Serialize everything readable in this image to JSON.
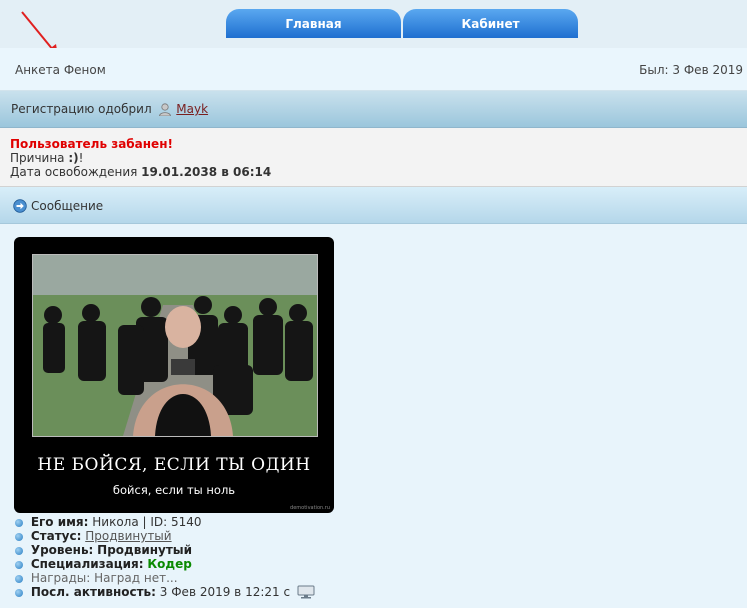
{
  "nav": {
    "tabs": [
      {
        "label": "Главная"
      },
      {
        "label": "Кабинет"
      }
    ]
  },
  "anketa": {
    "title": "Анкета Феном",
    "last_seen": "Был: 3 Фев 2019"
  },
  "registration": {
    "prefix": "Регистрацию одобрил",
    "approver": "Mayk"
  },
  "ban": {
    "title": "Пользователь забанен!",
    "reason_label": "Причина",
    "reason_value": ":)",
    "reason_suffix": "!",
    "date_label": "Дата освобождения",
    "date_value": "19.01.2038 в 06:14"
  },
  "message": {
    "label": "Сообщение"
  },
  "poster": {
    "title": "НЕ БОЙСЯ, ЕСЛИ ТЫ ОДИН",
    "subtitle": "бойся, если ты ноль",
    "watermark": "demotivation.ru"
  },
  "profile": {
    "name_label": "Его имя:",
    "name_value": "Никола | ID: 5140",
    "status_label": "Статус:",
    "status_value": "Продвинутый",
    "level_label": "Уровень:",
    "level_value": "Продвинутый",
    "spec_label": "Специализация:",
    "spec_value": "Кодер",
    "awards_label": "Награды:",
    "awards_value": "Наград нет...",
    "activity_label": "Посл. активность:",
    "activity_value": "3 Фев 2019 в 12:21 с"
  },
  "colors": {
    "tab_bg": "#2a7fdc",
    "banned_red": "#e00000",
    "spec_green": "#0a8a00",
    "approver_link": "#7a1e1e"
  }
}
